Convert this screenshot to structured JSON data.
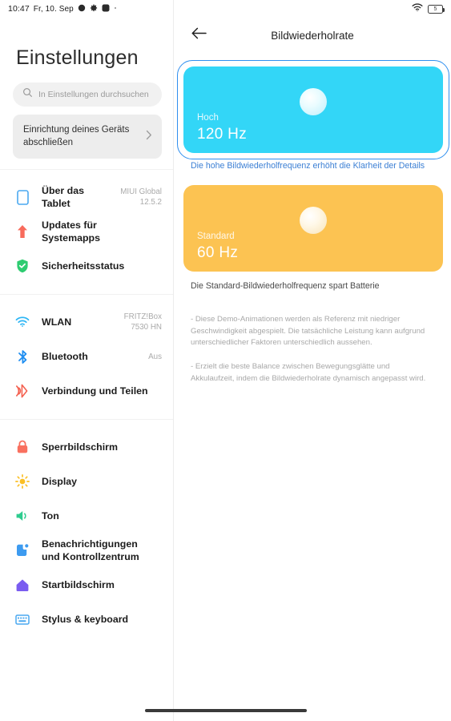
{
  "statusbar": {
    "time": "10:47",
    "date": "Fr, 10. Sep",
    "icons": [
      "moon-icon",
      "gear-icon",
      "app-icon",
      "dot-icon"
    ],
    "wifi_icon": "wifi-icon",
    "battery_level": "5"
  },
  "sidebar": {
    "title": "Einstellungen",
    "search": {
      "placeholder": "In Einstellungen durchsuchen",
      "icon": "search-icon"
    },
    "setup_card": {
      "text": "Einrichtung deines Geräts abschließen",
      "chevron": "chevron-right-icon"
    },
    "groups": [
      {
        "items": [
          {
            "label": "Über das Tablet",
            "value": "MIUI Global 12.5.2",
            "icon": "tablet-icon",
            "color": "#4aa8f0"
          },
          {
            "label": "Updates für Systemapps",
            "value": "",
            "icon": "arrow-up-icon",
            "color": "#f86b5c"
          },
          {
            "label": "Sicherheitsstatus",
            "value": "",
            "icon": "shield-check-icon",
            "color": "#2ecc71"
          }
        ]
      },
      {
        "items": [
          {
            "label": "WLAN",
            "value": "FRITZ!Box 7530 HN",
            "icon": "wifi-icon",
            "color": "#2eb6f5"
          },
          {
            "label": "Bluetooth",
            "value": "Aus",
            "icon": "bluetooth-icon",
            "color": "#1f8ef1"
          },
          {
            "label": "Verbindung und Teilen",
            "value": "",
            "icon": "share-connection-icon",
            "color": "#f4604f"
          }
        ]
      },
      {
        "items": [
          {
            "label": "Sperrbildschirm",
            "value": "",
            "icon": "lock-icon",
            "color": "#f9705f"
          },
          {
            "label": "Display",
            "value": "",
            "icon": "brightness-icon",
            "color": "#fbbf24"
          },
          {
            "label": "Ton",
            "value": "",
            "icon": "speaker-icon",
            "color": "#2ecc8f"
          },
          {
            "label": "Benachrichtigungen und Kontrollzentrum",
            "value": "",
            "icon": "notification-icon",
            "color": "#3d9bf0"
          },
          {
            "label": "Startbildschirm",
            "value": "",
            "icon": "home-icon",
            "color": "#7a5cf0"
          },
          {
            "label": "Stylus & keyboard",
            "value": "",
            "icon": "keyboard-icon",
            "color": "#4aa8f0"
          }
        ]
      }
    ]
  },
  "main": {
    "back_icon": "arrow-left-icon",
    "title": "Bildwiederholrate",
    "options": [
      {
        "name": "Hoch",
        "rate": "120 Hz",
        "caption": "Die hohe Bildwiederholfrequenz erhöht die Klarheit der Details",
        "color": "#33D6F7",
        "selected": true
      },
      {
        "name": "Standard",
        "rate": "60 Hz",
        "caption": "Die Standard-Bildwiederholfrequenz spart Batterie",
        "color": "#FCC352",
        "selected": false
      }
    ],
    "notes": [
      "- Diese Demo-Animationen werden als Referenz mit niedriger Geschwindigkeit abgespielt. Die tatsächliche Leistung kann aufgrund unterschiedlicher Faktoren unterschiedlich aussehen.",
      "- Erzielt die beste Balance zwischen Bewegungsglätte und Akkulaufzeit, indem die Bildwiederholrate dynamisch angepasst wird."
    ]
  },
  "colors": {
    "accent_blue": "#2f8fef",
    "cyan_card": "#33D6F7",
    "orange_card": "#FCC352"
  }
}
